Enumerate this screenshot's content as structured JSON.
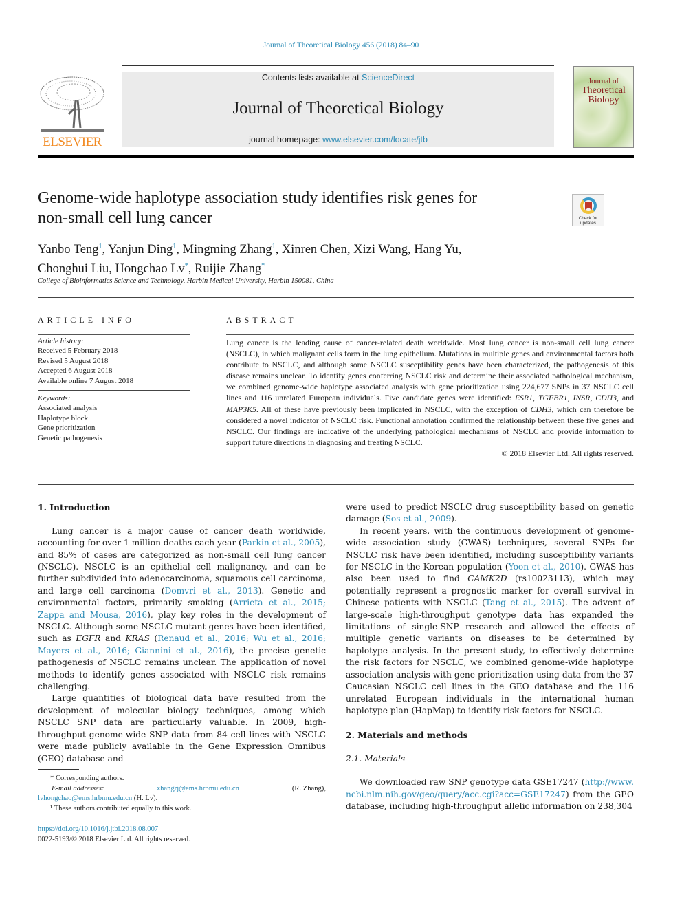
{
  "running_head": "Journal of Theoretical Biology 456 (2018) 84–90",
  "header": {
    "publisher_name": "ELSEVIER",
    "contents_prefix": "Contents lists available at ",
    "contents_link": "ScienceDirect",
    "journal_title": "Journal of Theoretical Biology",
    "homepage_prefix": "journal homepage: ",
    "homepage_link": "www.elsevier.com/locate/jtb",
    "cover": {
      "line1": "Journal of",
      "line2": "Theoretical",
      "line3": "Biology"
    },
    "colors": {
      "link": "#2a8ab5",
      "elsevier_orange": "#f28b24",
      "cover_title": "#8a1f1f"
    }
  },
  "article": {
    "title_line1": "Genome-wide haplotype association study identifies risk genes for",
    "title_line2": "non-small cell lung cancer",
    "crossmark": {
      "icon": "check-for-updates-icon",
      "line1": "Check for",
      "line2": "updates"
    },
    "authors": [
      {
        "name": "Yanbo Teng",
        "mark": "1"
      },
      {
        "name": "Yanjun Ding",
        "mark": "1"
      },
      {
        "name": "Mingming Zhang",
        "mark": "1"
      },
      {
        "name": "Xinren Chen",
        "mark": ""
      },
      {
        "name": "Xizi Wang",
        "mark": ""
      },
      {
        "name": "Hang Yu",
        "mark": ""
      },
      {
        "name": "Chonghui Liu",
        "mark": ""
      },
      {
        "name": "Hongchao Lv",
        "mark": "*"
      },
      {
        "name": "Ruijie Zhang",
        "mark": "*"
      }
    ],
    "affiliation": "College of Bioinformatics Science and Technology, Harbin Medical University, Harbin 150081, China"
  },
  "article_info": {
    "heading": "ARTICLE INFO",
    "history_label": "Article history:",
    "history": [
      "Received 5 February 2018",
      "Revised 5 August 2018",
      "Accepted 6 August 2018",
      "Available online 7 August 2018"
    ],
    "keywords_label": "Keywords:",
    "keywords": [
      "Associated analysis",
      "Haplotype block",
      "Gene prioritization",
      "Genetic pathogenesis"
    ]
  },
  "abstract": {
    "heading": "ABSTRACT",
    "text_a": "Lung cancer is the leading cause of cancer-related death worldwide. Most lung cancer is non-small cell lung cancer (NSCLC), in which malignant cells form in the lung epithelium. Mutations in multiple genes and environmental factors both contribute to NSCLC, and although some NSCLC susceptibility genes have been characterized, the pathogenesis of this disease remains unclear. To identify genes conferring NSCLC risk and determine their associated pathological mechanism, we combined genome-wide haplotype associated analysis with gene prioritization using 224,677 SNPs in 37 NSCLC cell lines and 116 unrelated European individuals. Five candidate genes were identified: ",
    "genes": [
      "ESR1",
      "TGFBR1",
      "INSR",
      "CDH3",
      "MAP3K5"
    ],
    "text_b": ". All of these have previously been implicated in NSCLC, with the exception of ",
    "exception_gene": "CDH3",
    "text_c": ", which can therefore be considered a novel indicator of NSCLC risk. Functional annotation confirmed the relationship between these five genes and NSCLC. Our findings are indicative of the underlying pathological mechanisms of NSCLC and provide information to support future directions in diagnosing and treating NSCLC.",
    "copyright": "© 2018 Elsevier Ltd. All rights reserved."
  },
  "body": {
    "intro_heading": "1. Introduction",
    "intro_p1": {
      "t1": "Lung cancer is a major cause of cancer death worldwide, accounting for over 1 million deaths each year (",
      "c1": "Parkin et al., 2005",
      "t2": "), and 85% of cases are categorized as non-small cell lung cancer (NSCLC). NSCLC is an epithelial cell malignancy, and can be further subdivided into adenocarcinoma, squamous cell carcinoma, and large cell carcinoma (",
      "c2": "Domvri et al., 2013",
      "t3": "). Genetic and environmental factors, primarily smoking (",
      "c3": "Arrieta et al., 2015; Zappa and Mousa, 2016",
      "t4": "), play key roles in the development of NSCLC. Although some NSCLC mutant genes have been identified, such as ",
      "g1": "EGFR",
      "t5": " and ",
      "g2": "KRAS",
      "t6": " (",
      "c4": "Renaud et al., 2016; Wu et al., 2016; Mayers et al., 2016; Giannini et al., 2016",
      "t7": "), the precise genetic pathogenesis of NSCLC remains unclear. The application of novel methods to identify genes associated with NSCLC risk remains challenging."
    },
    "intro_p2": "Large quantities of biological data have resulted from the development of molecular biology techniques, among which NSCLC SNP data are particularly valuable. In 2009, high-throughput genome-wide SNP data from 84 cell lines with NSCLC were made publicly available in the Gene Expression Omnibus (GEO) database and",
    "right_p0": {
      "t1": "were used to predict NSCLC drug susceptibility based on genetic damage (",
      "c1": "Sos et al., 2009",
      "t2": ")."
    },
    "right_p1": {
      "t1": "In recent years, with the continuous development of genome-wide association study (GWAS) techniques, several SNPs for NSCLC risk have been identified, including susceptibility variants for NSCLC in the Korean population (",
      "c1": "Yoon et al., 2010",
      "t2": "). GWAS has also been used to find ",
      "g1": "CAMK2D",
      "t3": " (rs10023113), which may potentially represent a prognostic marker for overall survival in Chinese patients with NSCLC (",
      "c2": "Tang et al., 2015",
      "t4": "). The advent of large-scale high-throughput genotype data has expanded the limitations of single-SNP research and allowed the effects of multiple genetic variants on diseases to be determined by haplotype analysis. In the present study, to effectively determine the risk factors for NSCLC, we combined genome-wide haplotype association analysis with gene prioritization using data from the 37 Caucasian NSCLC cell lines in the GEO database and the 116 unrelated European individuals in the international human haplotype plan (HapMap) to identify risk factors for NSCLC."
    },
    "methods_heading": "2. Materials and methods",
    "materials_heading": "2.1.  Materials",
    "materials_p": {
      "t1": "We downloaded raw SNP genotype data GSE17247 (",
      "link": "http://www.ncbi.nlm.nih.gov/geo/query/acc.cgi?acc=GSE17247",
      "t2": ") from the GEO database, including high-throughput allelic information on 238,304"
    }
  },
  "footnotes": {
    "corresponding": "* Corresponding authors.",
    "email_label": "E-mail addresses:",
    "email1": "zhangrj@ems.hrbmu.edu.cn",
    "email1_who": "(R. Zhang),",
    "email2": "lvhongchao@ems.hrbmu.edu.cn",
    "email2_who": " (H. Lv).",
    "equal": "¹ These authors contributed equally to this work.",
    "doi": "https://doi.org/10.1016/j.jtbi.2018.08.007",
    "issn": "0022-5193/© 2018 Elsevier Ltd. All rights reserved."
  }
}
